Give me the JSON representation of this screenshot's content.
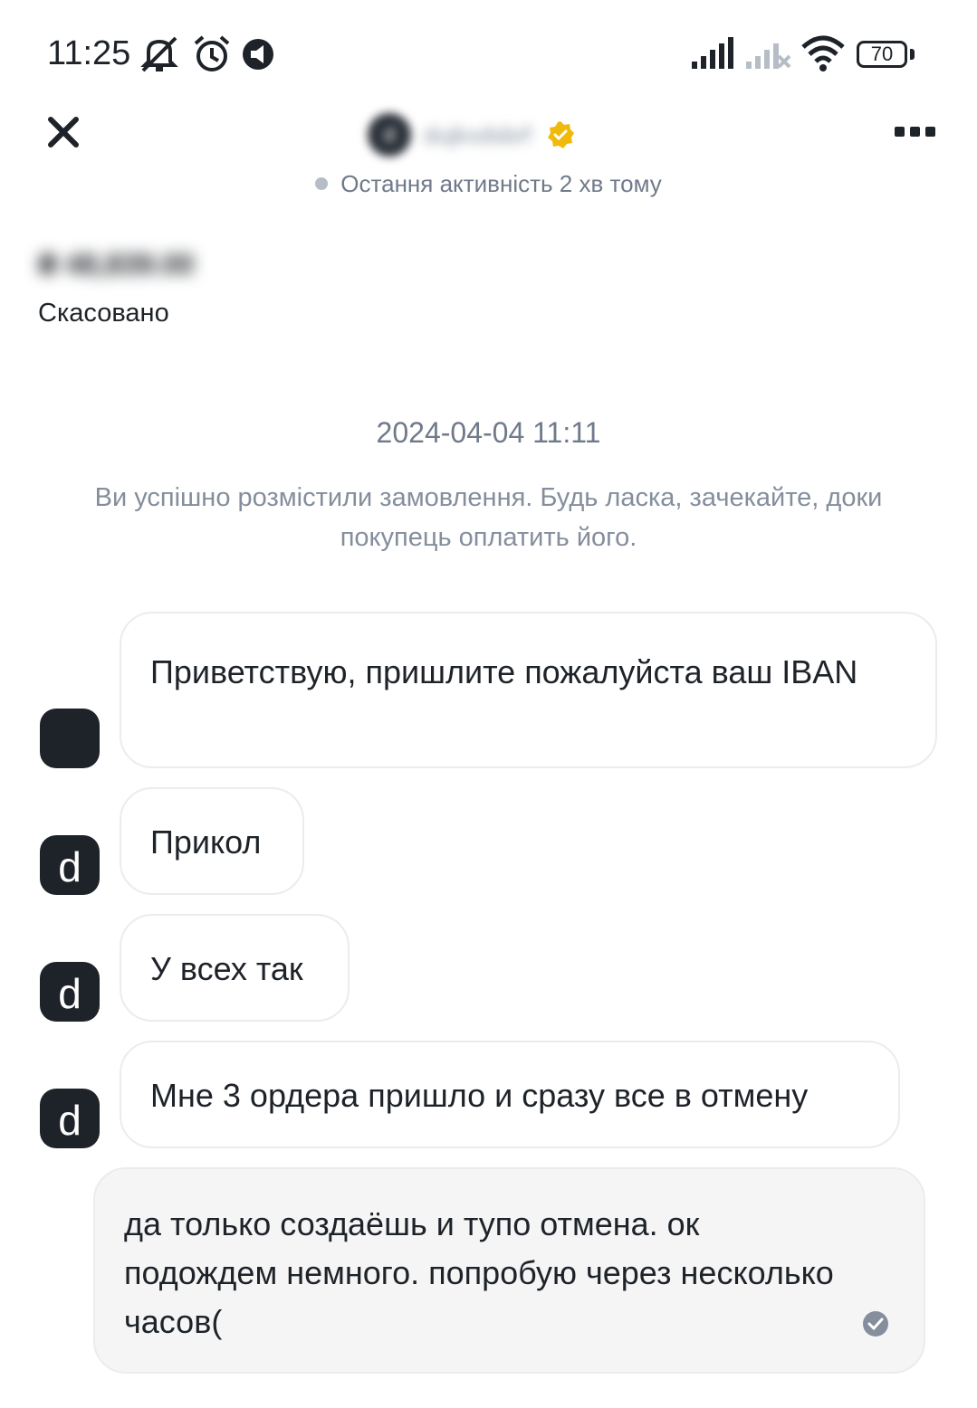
{
  "status_bar": {
    "time": "11:25",
    "battery": "70",
    "icons": [
      "bell-off-icon",
      "alarm-icon",
      "notification-icon",
      "signal-icon",
      "signal-no-sim-icon",
      "wifi-icon",
      "battery-icon"
    ]
  },
  "header": {
    "peer_name": "dujkxdsbrf",
    "peer_initial": "d",
    "verified_icon": "verified-badge-icon",
    "activity": "Остання активність 2 хв тому"
  },
  "order": {
    "amount": "₴ 48,839.00",
    "status": "Скасовано"
  },
  "system": {
    "timestamp": "2024-04-04 11:11",
    "message": "Ви успішно розмістили замовлення. Будь ласка, зачекайте, доки покупець оплатить його."
  },
  "messages": [
    {
      "from": "peer",
      "avatar_letter": "",
      "text": "Приветствую, пришлите пожалуйста ваш IBAN"
    },
    {
      "from": "peer",
      "avatar_letter": "d",
      "text": "Прикол"
    },
    {
      "from": "peer",
      "avatar_letter": "d",
      "text": "У всех так"
    },
    {
      "from": "peer",
      "avatar_letter": "d",
      "text": "Мне 3 ордера пришло и сразу все в отмену"
    },
    {
      "from": "me",
      "text": "да только создаёшь и тупо отмена. ок подождем немного. попробую через несколько часов("
    }
  ],
  "colors": {
    "text": "#1e2329",
    "muted": "#848e9c",
    "brand_yellow": "#f0b90b",
    "avatar_bg": "#1e2329",
    "bubble_border": "#eaecef"
  }
}
